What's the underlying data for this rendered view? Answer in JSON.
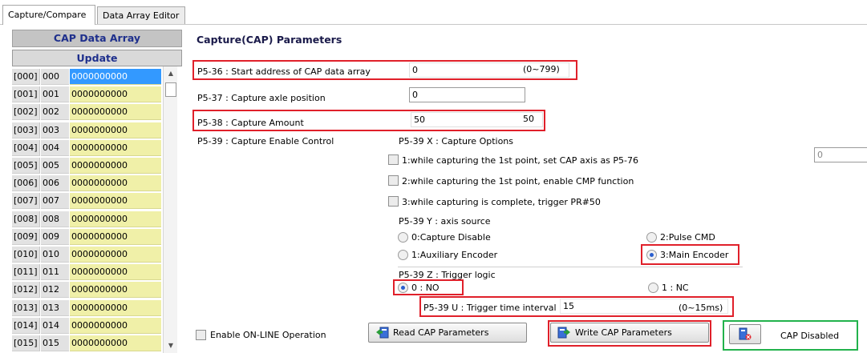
{
  "tabs": [
    {
      "label": "Capture/Compare"
    },
    {
      "label": "Data Array Editor"
    }
  ],
  "cap_panel": {
    "title": "CAP Data Array",
    "update_label": "Update",
    "rows": [
      {
        "index": "[000]",
        "addr": "000",
        "value": "0000000000"
      },
      {
        "index": "[001]",
        "addr": "001",
        "value": "0000000000"
      },
      {
        "index": "[002]",
        "addr": "002",
        "value": "0000000000"
      },
      {
        "index": "[003]",
        "addr": "003",
        "value": "0000000000"
      },
      {
        "index": "[004]",
        "addr": "004",
        "value": "0000000000"
      },
      {
        "index": "[005]",
        "addr": "005",
        "value": "0000000000"
      },
      {
        "index": "[006]",
        "addr": "006",
        "value": "0000000000"
      },
      {
        "index": "[007]",
        "addr": "007",
        "value": "0000000000"
      },
      {
        "index": "[008]",
        "addr": "008",
        "value": "0000000000"
      },
      {
        "index": "[009]",
        "addr": "009",
        "value": "0000000000"
      },
      {
        "index": "[010]",
        "addr": "010",
        "value": "0000000000"
      },
      {
        "index": "[011]",
        "addr": "011",
        "value": "0000000000"
      },
      {
        "index": "[012]",
        "addr": "012",
        "value": "0000000000"
      },
      {
        "index": "[013]",
        "addr": "013",
        "value": "0000000000"
      },
      {
        "index": "[014]",
        "addr": "014",
        "value": "0000000000"
      },
      {
        "index": "[015]",
        "addr": "015",
        "value": "0000000000"
      }
    ]
  },
  "params": {
    "title": "Capture(CAP) Parameters",
    "p5_36": {
      "label": "P5-36 : Start address of CAP data array",
      "value": "0",
      "range": "(0~799)"
    },
    "p5_37": {
      "label": "P5-37 : Capture axle position",
      "value": "0"
    },
    "p5_38": {
      "label": "P5-38 : Capture Amount",
      "value": "50",
      "max": "50"
    },
    "p5_39": {
      "label": "P5-39 : Capture Enable Control"
    },
    "x_options": {
      "title": "P5-39 X : Capture Options",
      "opt1": "1:while capturing the 1st point, set CAP axis as P5-76",
      "opt1_value": "0",
      "opt2": "2:while capturing the 1st point, enable CMP function",
      "opt3": "3:while capturing is complete, trigger PR#50"
    },
    "y_source": {
      "title": "P5-39 Y : axis source",
      "opt0": "0:Capture Disable",
      "opt1": "1:Auxiliary Encoder",
      "opt2": "2:Pulse CMD",
      "opt3": "3:Main Encoder"
    },
    "z_logic": {
      "title": "P5-39 Z : Trigger logic",
      "opt0": "0 : NO",
      "opt1": "1 : NC"
    },
    "u_interval": {
      "label": "P5-39 U : Trigger time interval",
      "value": "15",
      "range": "(0~15ms)"
    }
  },
  "bottom": {
    "online_label": "Enable ON-LINE Operation",
    "read_label": "Read CAP Parameters",
    "write_label": "Write CAP Parameters",
    "status": "CAP Disabled"
  },
  "colors": {
    "highlight_red": "#e0202a",
    "highlight_green": "#22b24c",
    "cell_yellow": "#f0f0a8",
    "selected_blue": "#3399ff"
  }
}
